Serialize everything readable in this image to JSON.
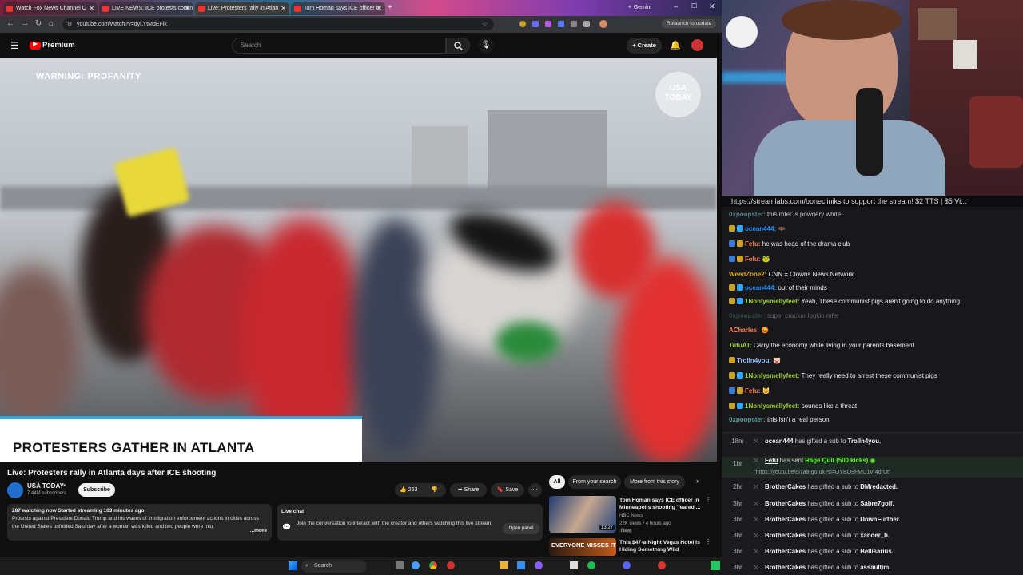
{
  "browser": {
    "tabs": [
      {
        "label": "Watch Fox News Channel O"
      },
      {
        "label": "LIVE NEWS: ICE protests contin"
      },
      {
        "label": "Live: Protesters rally in Atlan"
      },
      {
        "label": "Tom Homan says ICE officer in"
      }
    ],
    "gemini_label": "Gemini",
    "url": "youtube.com/watch?v=dyLYtMdEFlk",
    "relaunch_label": "Relaunch to update"
  },
  "youtube": {
    "logo_label": "Premium",
    "search_placeholder": "Search",
    "create_label": "Create"
  },
  "video": {
    "warning": "WARNING: PROFANITY",
    "watermark": "USA TODAY",
    "lower_third": "PROTESTERS GATHER IN ATLANTA",
    "title": "Live: Protesters rally in Atlanta days after ICE shooting",
    "channel": "USA TODAY",
    "subscribers": "7.44M subscribers",
    "subscribe_label": "Subscribe",
    "likes": "263",
    "share_label": "Share",
    "save_label": "Save",
    "description_stats": "287 watching now  Started streaming 103 minutes ago",
    "description_text": "Protests against President Donald Trump and his waves of immigration enforcement actions in cities across the United States unfolded Saturday after a woman was killed and two people were inju",
    "more_label": "...more"
  },
  "live_chat": {
    "title": "Live chat",
    "text": "Join the conversation to interact with the creator and others watching this live stream.",
    "open_panel_label": "Open panel"
  },
  "filters": [
    "All",
    "From your search",
    "More from this story"
  ],
  "recommendations": [
    {
      "title": "Tom Homan says ICE officer in Minneapolis shooting 'feared ...",
      "channel": "NBC News",
      "meta": "22K views • 4 hours ago",
      "badge": "New",
      "duration": "13:27"
    },
    {
      "title": "This $47-a-Night Vegas Hotel Is Hiding Something Wild",
      "thumb_text": "EVERYONE MISSES IT"
    }
  ],
  "taskbar": {
    "search_label": "Search"
  },
  "stream": {
    "banner": "https://streamlabs.com/bonecliniks to support the stream! $2 TTS | $5 Vi..."
  },
  "chat": [
    {
      "user": "0xpoopster:",
      "text": "this mfer is powdery white",
      "color": "#5f9ea0"
    },
    {
      "user": "ocean444:",
      "text": "🦇",
      "color": "#1e90ff"
    },
    {
      "user": "Fefu:",
      "text": "he was head of the drama club",
      "color": "#ff7f50"
    },
    {
      "user": "Fefu:",
      "text": "🐸",
      "color": "#ff7f50"
    },
    {
      "user": "WeedZone2:",
      "text": "CNN = Clowns News Network",
      "color": "#daa520"
    },
    {
      "user": "ocean444:",
      "text": "out of their minds",
      "color": "#1e90ff"
    },
    {
      "user": "1Nonlysmellyfeet:",
      "text": "Yeah, These communist pigs aren't going to do anything",
      "color": "#9acd32"
    },
    {
      "user": "0xpoopster:",
      "text": "super cracker lookin mfer",
      "color": "#5f9ea0"
    },
    {
      "user": "ACharles:",
      "text": "😡",
      "color": "#ff7f50"
    },
    {
      "user": "TutuAT:",
      "text": "Carry the economy while living in your parents basement",
      "color": "#9acd32"
    },
    {
      "user": "Trolln4you:",
      "text": "🐷",
      "color": "#8fbcff"
    },
    {
      "user": "1Nonlysmellyfeet:",
      "text": "They really need to arrest these communist pigs",
      "color": "#9acd32"
    },
    {
      "user": "Fefu:",
      "text": "🐱",
      "color": "#ff7f50"
    },
    {
      "user": "1Nonlysmellyfeet:",
      "text": "sounds like a threat",
      "color": "#9acd32"
    },
    {
      "user": "0xpoopster:",
      "text": "this isn't a real person",
      "color": "#5f9ea0"
    }
  ],
  "events": [
    {
      "time": "18m",
      "user": "ocean444",
      "action": "has gifted a sub to",
      "target": "Trolln4you."
    },
    {
      "time": "1hr",
      "user": "Fefu",
      "action": "has sent",
      "target": "Rage Quit (500 kicks)",
      "link": "\"https://youtu.be/qi7a8-goIuk?si=OYBO9FMU1Vr4drUt\""
    },
    {
      "time": "2hr",
      "user": "BrotherCakes",
      "action": "has gifted a sub to",
      "target": "DMredacted."
    },
    {
      "time": "3hr",
      "user": "BrotherCakes",
      "action": "has gifted a sub to",
      "target": "Sabre7golf."
    },
    {
      "time": "3hr",
      "user": "BrotherCakes",
      "action": "has gifted a sub to",
      "target": "DownFurther."
    },
    {
      "time": "3hr",
      "user": "BrotherCakes",
      "action": "has gifted a sub to",
      "target": "xander_b."
    },
    {
      "time": "3hr",
      "user": "BrotherCakes",
      "action": "has gifted a sub to",
      "target": "Bellisarius."
    },
    {
      "time": "3hr",
      "user": "BrotherCakes",
      "action": "has gifted a sub to",
      "target": "assaultim."
    }
  ]
}
